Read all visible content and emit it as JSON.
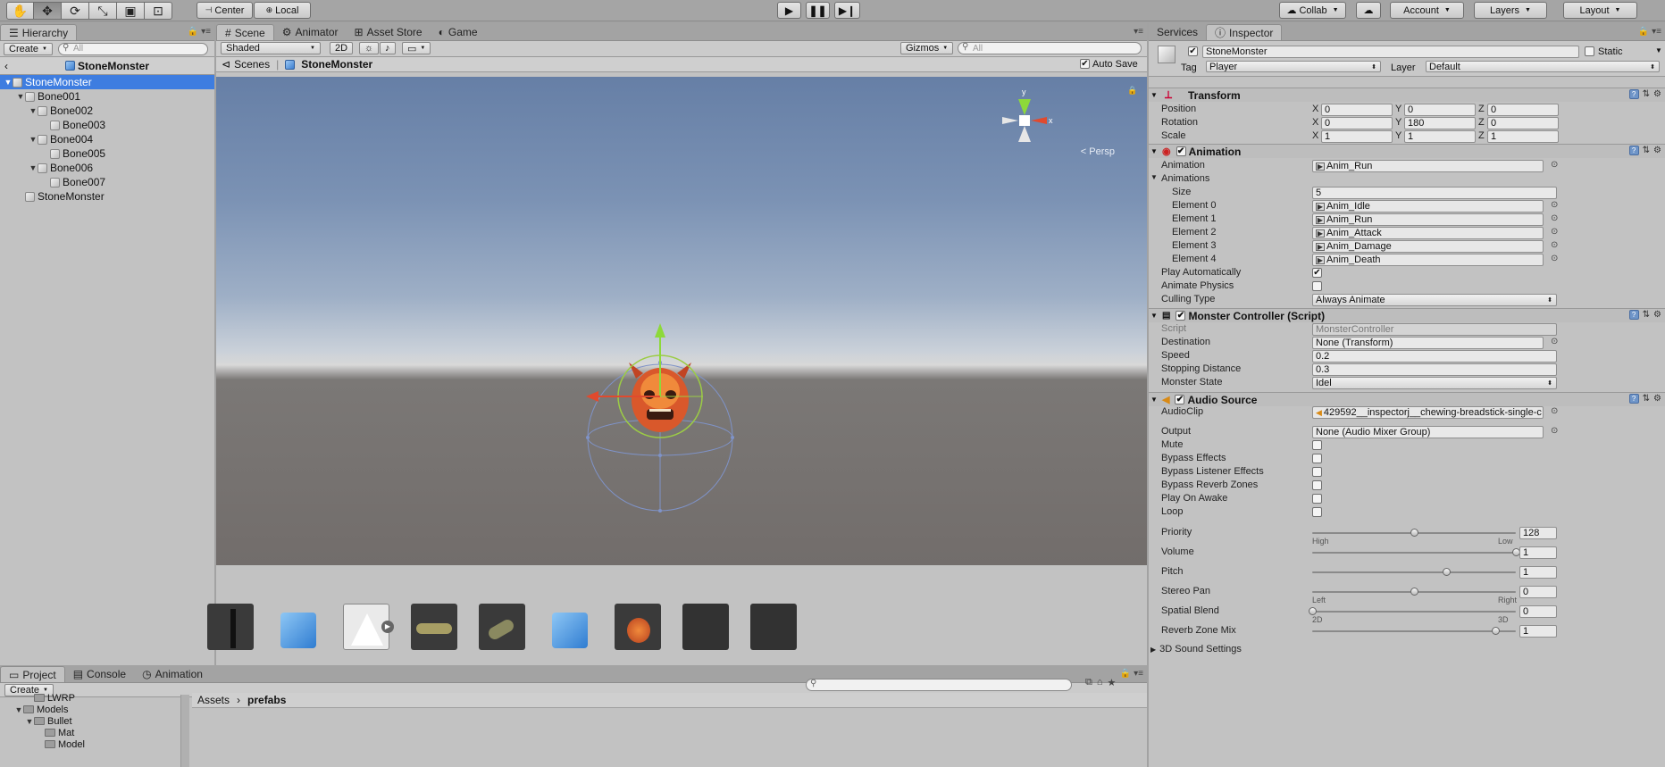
{
  "toolbar": {
    "pivot_label": "Center",
    "space_label": "Local",
    "collab_label": "Collab",
    "account_label": "Account",
    "layers_label": "Layers",
    "layout_label": "Layout"
  },
  "hierarchy": {
    "tab": "Hierarchy",
    "create": "Create",
    "search_placeholder": "All",
    "breadcrumb": "StoneMonster",
    "items": [
      {
        "label": "StoneMonster",
        "depth": 0,
        "expanded": true,
        "selected": true
      },
      {
        "label": "Bone001",
        "depth": 1,
        "expanded": true
      },
      {
        "label": "Bone002",
        "depth": 2,
        "expanded": true
      },
      {
        "label": "Bone003",
        "depth": 3
      },
      {
        "label": "Bone004",
        "depth": 2,
        "expanded": true
      },
      {
        "label": "Bone005",
        "depth": 3
      },
      {
        "label": "Bone006",
        "depth": 2,
        "expanded": true
      },
      {
        "label": "Bone007",
        "depth": 3
      },
      {
        "label": "StoneMonster",
        "depth": 1
      }
    ]
  },
  "scene": {
    "tabs": [
      "Scene",
      "Animator",
      "Asset Store",
      "Game"
    ],
    "shading": "Shaded",
    "mode_2d": "2D",
    "gizmos": "Gizmos",
    "search_placeholder": "All",
    "breadcrumb_root": "Scenes",
    "breadcrumb_current": "StoneMonster",
    "auto_save": "Auto Save",
    "persp": "< Persp",
    "gizmo_axes": {
      "x": "x",
      "y": "y"
    }
  },
  "inspector": {
    "tabs": [
      "Services",
      "Inspector"
    ],
    "object_name": "StoneMonster",
    "static_label": "Static",
    "tag_label": "Tag",
    "tag_value": "Player",
    "layer_label": "Layer",
    "layer_value": "Default",
    "transform": {
      "title": "Transform",
      "position": {
        "label": "Position",
        "x": "0",
        "y": "0",
        "z": "0"
      },
      "rotation": {
        "label": "Rotation",
        "x": "0",
        "y": "180",
        "z": "0"
      },
      "scale": {
        "label": "Scale",
        "x": "1",
        "y": "1",
        "z": "1"
      }
    },
    "animation": {
      "title": "Animation",
      "animation_label": "Animation",
      "animation_value": "Anim_Run",
      "animations_label": "Animations",
      "size_label": "Size",
      "size_value": "5",
      "elements": [
        {
          "label": "Element 0",
          "value": "Anim_Idle"
        },
        {
          "label": "Element 1",
          "value": "Anim_Run"
        },
        {
          "label": "Element 2",
          "value": "Anim_Attack"
        },
        {
          "label": "Element 3",
          "value": "Anim_Damage"
        },
        {
          "label": "Element 4",
          "value": "Anim_Death"
        }
      ],
      "play_auto_label": "Play Automatically",
      "play_auto": true,
      "animate_physics_label": "Animate Physics",
      "animate_physics": false,
      "culling_label": "Culling Type",
      "culling_value": "Always Animate"
    },
    "monster": {
      "title": "Monster Controller (Script)",
      "script_label": "Script",
      "script_value": "MonsterController",
      "destination_label": "Destination",
      "destination_value": "None (Transform)",
      "speed_label": "Speed",
      "speed_value": "0.2",
      "stopping_label": "Stopping Distance",
      "stopping_value": "0.3",
      "state_label": "Monster State",
      "state_value": "Idel"
    },
    "audio": {
      "title": "Audio Source",
      "clip_label": "AudioClip",
      "clip_value": "429592__inspectorj__chewing-breadstick-single-c",
      "output_label": "Output",
      "output_value": "None (Audio Mixer Group)",
      "toggles": [
        {
          "label": "Mute",
          "checked": false
        },
        {
          "label": "Bypass Effects",
          "checked": false
        },
        {
          "label": "Bypass Listener Effects",
          "checked": false
        },
        {
          "label": "Bypass Reverb Zones",
          "checked": false
        },
        {
          "label": "Play On Awake",
          "checked": false
        },
        {
          "label": "Loop",
          "checked": false
        }
      ],
      "sliders": [
        {
          "label": "Priority",
          "value": "128",
          "fraction": 0.5,
          "left": "High",
          "right": "Low"
        },
        {
          "label": "Volume",
          "value": "1",
          "fraction": 1.0
        },
        {
          "label": "Pitch",
          "value": "1",
          "fraction": 0.66
        },
        {
          "label": "Stereo Pan",
          "value": "0",
          "fraction": 0.5,
          "left": "Left",
          "right": "Right"
        },
        {
          "label": "Spatial Blend",
          "value": "0",
          "fraction": 0.0,
          "left": "2D",
          "right": "3D"
        },
        {
          "label": "Reverb Zone Mix",
          "value": "1",
          "fraction": 0.9
        }
      ],
      "sound_settings_label": "3D Sound Settings"
    }
  },
  "project": {
    "tabs": [
      "Project",
      "Console",
      "Animation"
    ],
    "create": "Create",
    "tree": [
      {
        "label": "LWRP",
        "depth": 1
      },
      {
        "label": "Models",
        "depth": 0,
        "expanded": true
      },
      {
        "label": "Bullet",
        "depth": 1,
        "expanded": true
      },
      {
        "label": "Mat",
        "depth": 2
      },
      {
        "label": "Model",
        "depth": 2
      }
    ],
    "path_root": "Assets",
    "path_current": "prefabs"
  },
  "colors": {
    "selection": "#3e7de0",
    "panel": "#c2c2c2",
    "sky_top": "#667fa6",
    "ground": "#726d6b"
  }
}
